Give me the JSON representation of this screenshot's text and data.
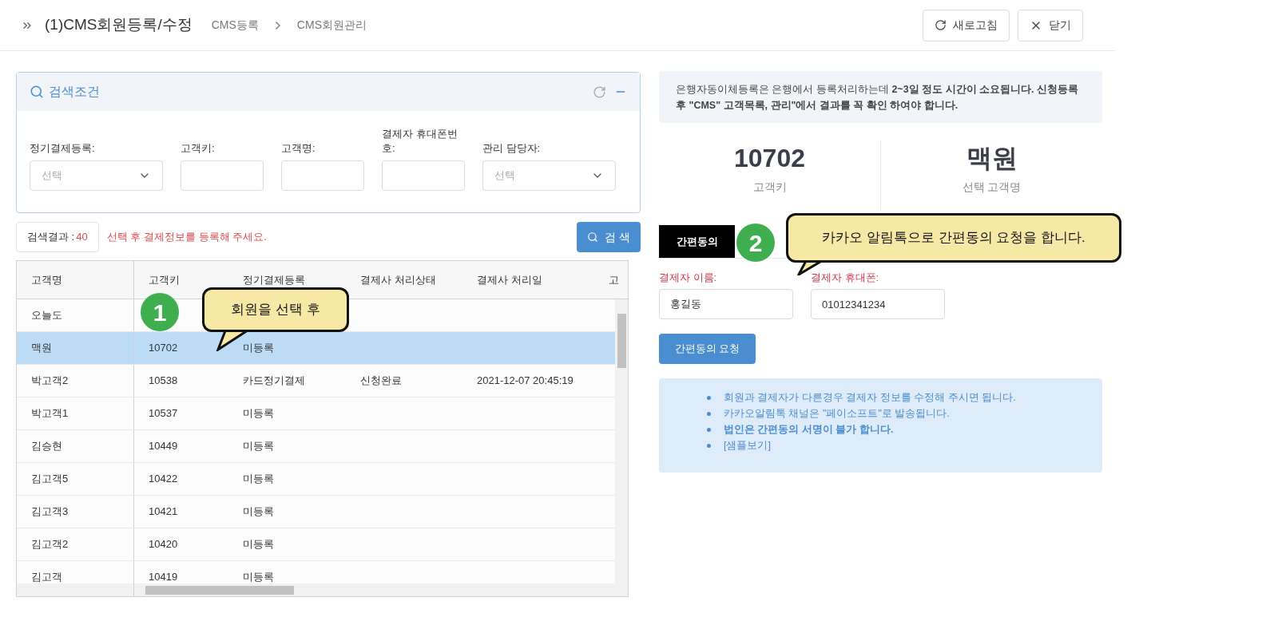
{
  "header": {
    "title": "(1)CMS회원등록/수정",
    "breadcrumb": [
      "CMS등록",
      "CMS회원관리"
    ],
    "buttons": [
      {
        "label": "새로고침",
        "kind": "refresh"
      },
      {
        "label": "닫기",
        "kind": "close"
      }
    ]
  },
  "search_panel": {
    "title": "검색조건",
    "fields": [
      {
        "label": "정기결제등록:",
        "kind": "select",
        "placeholder": "선택"
      },
      {
        "label": "고객키:",
        "kind": "text"
      },
      {
        "label": "고객명:",
        "kind": "text"
      },
      {
        "label": "결제자 휴대폰번호:",
        "kind": "text"
      },
      {
        "label": "관리 담당자:",
        "kind": "select",
        "placeholder": "선택"
      }
    ]
  },
  "result": {
    "label": "검색결과 :",
    "count": "40",
    "message": "선택 후 결제정보를 등록해 주세요.",
    "search_button": "검 색"
  },
  "table": {
    "columns": [
      "고객명",
      "고객키",
      "정기결제등록",
      "결제사 처리상태",
      "결제사 처리일",
      "고"
    ],
    "rows": [
      {
        "cells": [
          "오늘도",
          "",
          "",
          "",
          ""
        ],
        "selected": false
      },
      {
        "cells": [
          "맥원",
          "10702",
          "미등록",
          "",
          ""
        ],
        "selected": true
      },
      {
        "cells": [
          "박고객2",
          "10538",
          "카드정기결제",
          "신청완료",
          "2021-12-07 20:45:19"
        ],
        "selected": false
      },
      {
        "cells": [
          "박고객1",
          "10537",
          "미등록",
          "",
          ""
        ],
        "selected": false
      },
      {
        "cells": [
          "김승현",
          "10449",
          "미등록",
          "",
          ""
        ],
        "selected": false
      },
      {
        "cells": [
          "김고객5",
          "10422",
          "미등록",
          "",
          ""
        ],
        "selected": false
      },
      {
        "cells": [
          "김고객3",
          "10421",
          "미등록",
          "",
          ""
        ],
        "selected": false
      },
      {
        "cells": [
          "김고객2",
          "10420",
          "미등록",
          "",
          ""
        ],
        "selected": false
      },
      {
        "cells": [
          "김고객",
          "10419",
          "미등록",
          "",
          ""
        ],
        "selected": false
      }
    ]
  },
  "notice": "은행자동이체등록은 은행에서 등록처리하는데 **2~3일 정도 시간이 소요됩니다. 신청등록 후 \"CMS\" 고객목록, 관리\"에서 결과를 꼭 확인 하여야 합니다.**",
  "stats": [
    {
      "value": "10702",
      "label": "고객키"
    },
    {
      "value": "맥원",
      "label": "선택 고객명"
    }
  ],
  "tabs": [
    {
      "label": "간편동의",
      "selected": true
    }
  ],
  "payer_fields": [
    {
      "label": "결제자 이름:",
      "value": "홍길동"
    },
    {
      "label": "결제자 휴대폰:",
      "value": "01012341234"
    }
  ],
  "request_button": "간편동의 요청",
  "notes": [
    {
      "text": "회원과 결제자가 다른경우 결제자 정보를 수정해 주시면 됩니다.",
      "kind": "plain"
    },
    {
      "text": "카카오알림톡 채널은 \"페이소프트\"로 발송됩니다.",
      "kind": "plain"
    },
    {
      "text": "법인은 간편동의 서명이 불가 합니다.",
      "kind": "bold"
    },
    {
      "text": "[샘플보기]",
      "kind": "link"
    }
  ],
  "callouts": [
    {
      "number": "1",
      "text": "회원을 선택 후"
    },
    {
      "number": "2",
      "text": "카카오 알림톡으로 간편동의 요청을 합니다."
    }
  ]
}
